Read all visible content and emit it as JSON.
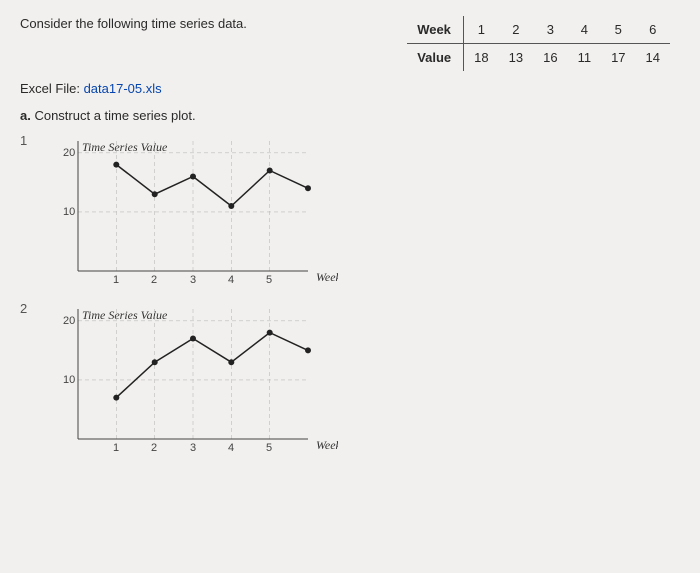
{
  "prompt_text": "Consider the following time series data.",
  "table": {
    "row_labels": [
      "Week",
      "Value"
    ],
    "weeks": [
      "1",
      "2",
      "3",
      "4",
      "5",
      "6"
    ],
    "values": [
      "18",
      "13",
      "16",
      "11",
      "17",
      "14"
    ]
  },
  "file_line_prefix": "Excel File: ",
  "file_link": "data17-05.xls",
  "question_prefix": "a.",
  "question_text": " Construct a time series plot.",
  "chart_option_indices": [
    "1",
    "2"
  ],
  "axis_title_y": "Time  Series   Value",
  "axis_title_x": "Week",
  "y_ticks": [
    "10",
    "20"
  ],
  "x_ticks": [
    "1",
    "2",
    "3",
    "4",
    "5"
  ],
  "chart_data": [
    {
      "type": "line",
      "title": "Time Series Value",
      "xlabel": "Week",
      "ylabel": "Time Series Value",
      "x": [
        1,
        2,
        3,
        4,
        5,
        6
      ],
      "y": [
        18,
        13,
        16,
        11,
        17,
        14
      ],
      "xlim": [
        0,
        6
      ],
      "ylim": [
        0,
        22
      ]
    },
    {
      "type": "line",
      "title": "Time Series Value",
      "xlabel": "Week",
      "ylabel": "Time Series Value",
      "x": [
        1,
        2,
        3,
        4,
        5,
        6
      ],
      "y": [
        7,
        13,
        17,
        13,
        18,
        15
      ],
      "xlim": [
        0,
        6
      ],
      "ylim": [
        0,
        22
      ]
    }
  ]
}
